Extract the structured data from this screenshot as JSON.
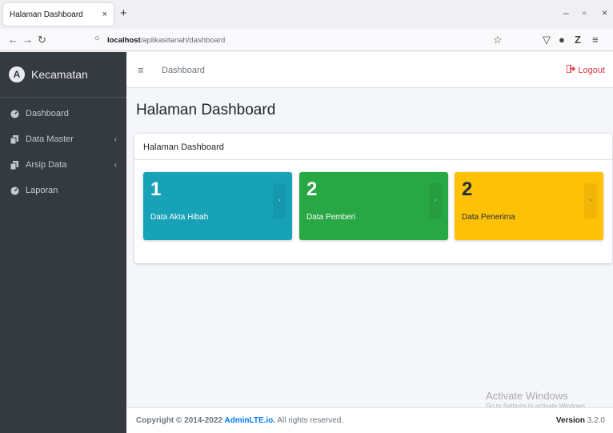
{
  "browser": {
    "tab_title": "Halaman Dashboard",
    "tab_close": "×",
    "new_tab": "+",
    "url_host": "localhost",
    "url_path": "/aplikasitanah/dashboard",
    "window": {
      "minimize": "–",
      "restore": "▫",
      "close": "×"
    }
  },
  "sidebar": {
    "brand_logo": "A",
    "brand": "Kecamatan",
    "items": [
      {
        "label": "Dashboard",
        "icon": "tachometer-icon",
        "has_arrow": false
      },
      {
        "label": "Data Master",
        "icon": "copy-icon",
        "has_arrow": true
      },
      {
        "label": "Arsip Data",
        "icon": "copy-icon",
        "has_arrow": true
      },
      {
        "label": "Laporan",
        "icon": "tachometer-icon",
        "has_arrow": false
      }
    ],
    "arrow": "‹"
  },
  "header": {
    "menu_icon": "≡",
    "link": "Dashboard",
    "logout": "Logout"
  },
  "page": {
    "title": "Halaman Dashboard",
    "card_title": "Halaman Dashboard"
  },
  "boxes": [
    {
      "value": "1",
      "label": "Data Akta Hibah",
      "color": "#17a2b8"
    },
    {
      "value": "2",
      "label": "Data Pemberi",
      "color": "#28a745"
    },
    {
      "value": "2",
      "label": "Data Penerima",
      "color": "#ffc107"
    }
  ],
  "footer": {
    "copyright_prefix": "Copyright © 2014-2022 ",
    "copyright_link": "AdminLTE.io.",
    "copyright_suffix": " All rights reserved.",
    "version_label": "Version",
    "version": "3.2.0"
  },
  "watermark": {
    "title": "Activate Windows",
    "subtitle": "Go to Settings to activate Windows."
  }
}
